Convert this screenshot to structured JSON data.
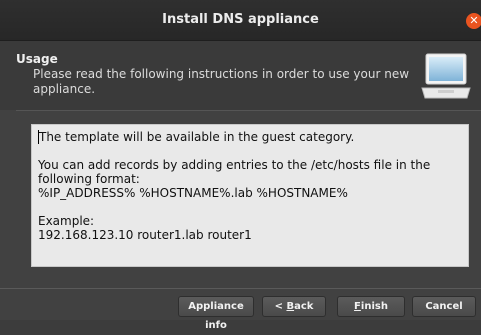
{
  "window": {
    "title": "Install DNS appliance",
    "close_glyph": "✕"
  },
  "header": {
    "section_title": "Usage",
    "description": "Please read the following instructions in order to use your new appliance.",
    "icon": "laptop-icon"
  },
  "instructions": {
    "paragraph1": "The template will be available in the guest category.",
    "paragraph2_line1": "You can add records by adding entries to the /etc/hosts file in the following format:",
    "paragraph2_line2": "%IP_ADDRESS% %HOSTNAME%.lab %HOSTNAME%",
    "paragraph3_line1": "Example:",
    "paragraph3_line2": "192.168.123.10 router1.lab router1"
  },
  "buttons": {
    "appliance_info": "Appliance info",
    "back_prefix": "< ",
    "back_mnemonic": "B",
    "back_rest": "ack",
    "finish_mnemonic": "F",
    "finish_rest": "inish",
    "cancel": "Cancel"
  }
}
